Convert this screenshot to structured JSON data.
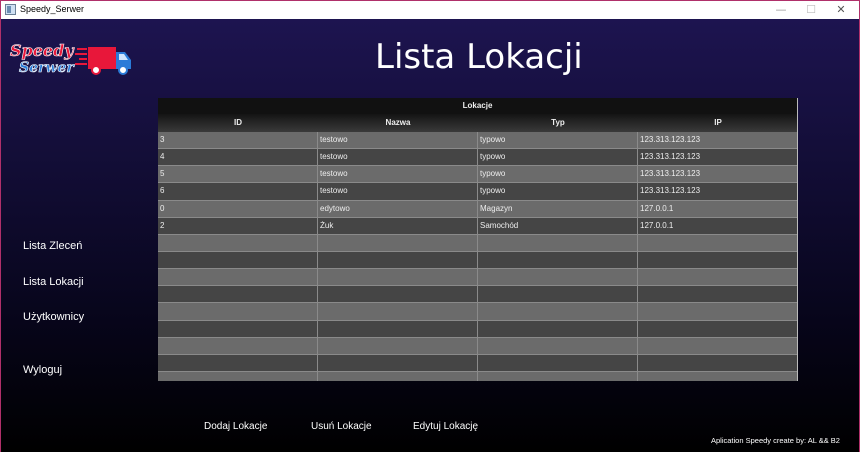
{
  "window": {
    "title": "Speedy_Serwer",
    "controls": {
      "minimize": "—",
      "maximize": "☐",
      "close": "✕"
    }
  },
  "logo": {
    "line1": "Speedy",
    "line2": "Serwer"
  },
  "page_title": "Lista Lokacji",
  "table": {
    "caption": "Lokacje",
    "columns": [
      "ID",
      "Nazwa",
      "Typ",
      "IP"
    ],
    "rows": [
      [
        "3",
        "testowo",
        "typowo",
        "123.313.123.123"
      ],
      [
        "4",
        "testowo",
        "typowo",
        "123.313.123.123"
      ],
      [
        "5",
        "testowo",
        "typowo",
        "123.313.123.123"
      ],
      [
        "6",
        "testowo",
        "typowo",
        "123.313.123.123"
      ],
      [
        "0",
        "edytowo",
        "Magazyn",
        "127.0.0.1"
      ],
      [
        "2",
        "Żuk",
        "Samochód",
        "127.0.0.1"
      ],
      [
        "",
        "",
        "",
        ""
      ],
      [
        "",
        "",
        "",
        ""
      ],
      [
        "",
        "",
        "",
        ""
      ],
      [
        "",
        "",
        "",
        ""
      ],
      [
        "",
        "",
        "",
        ""
      ],
      [
        "",
        "",
        "",
        ""
      ],
      [
        "",
        "",
        "",
        ""
      ],
      [
        "",
        "",
        "",
        ""
      ],
      [
        "",
        "",
        "",
        ""
      ]
    ]
  },
  "sidebar": {
    "items": [
      {
        "label": "Lista Zleceń",
        "name": "sidebar-item-lista-zlecen"
      },
      {
        "label": "Lista Lokacji",
        "name": "sidebar-item-lista-lokacji"
      },
      {
        "label": "Użytkownicy",
        "name": "sidebar-item-uzytkownicy"
      },
      {
        "label": "Wyloguj",
        "name": "sidebar-item-wyloguj"
      }
    ]
  },
  "actions": {
    "add": "Dodaj Lokacje",
    "remove": "Usuń Lokacje",
    "edit": "Edytuj Lokację"
  },
  "footer": {
    "credits": "Aplication Speedy create by: AL && B2"
  },
  "colors": {
    "accent": "#e8173a",
    "logo_blue": "#2a7bd8",
    "background_top": "#1d1450"
  }
}
